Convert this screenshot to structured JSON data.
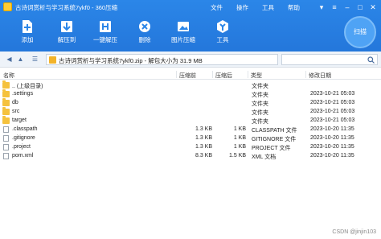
{
  "window": {
    "title": "古诗词赏析与学习系统7ykf0 - 360压缩",
    "menu": [
      "文件",
      "操作",
      "工具",
      "帮助"
    ]
  },
  "toolbar": {
    "items": [
      {
        "label": "添加",
        "icon": "add-file-icon"
      },
      {
        "label": "解压到",
        "icon": "extract-to-icon"
      },
      {
        "label": "一键解压",
        "icon": "one-click-extract-icon"
      },
      {
        "label": "删除",
        "icon": "delete-icon"
      },
      {
        "label": "图片压缩",
        "icon": "image-compress-icon"
      },
      {
        "label": "工具",
        "icon": "tools-icon"
      }
    ],
    "scan_label": "扫描"
  },
  "address": {
    "path": "古诗词赏析与学习系统7ykf0.zip - 解包大小为 31.9 MB",
    "v_badge": "V"
  },
  "table": {
    "headers": [
      "名称",
      "压缩前",
      "压缩后",
      "类型",
      "修改日期"
    ],
    "rows": [
      {
        "name": ".. (上级目录)",
        "before": "",
        "after": "",
        "type": "文件夹",
        "date": "",
        "kind": "folder"
      },
      {
        "name": ".settings",
        "before": "",
        "after": "",
        "type": "文件夹",
        "date": "2023-10-21 05:03",
        "kind": "folder"
      },
      {
        "name": "db",
        "before": "",
        "after": "",
        "type": "文件夹",
        "date": "2023-10-21 05:03",
        "kind": "folder"
      },
      {
        "name": "src",
        "before": "",
        "after": "",
        "type": "文件夹",
        "date": "2023-10-21 05:03",
        "kind": "folder"
      },
      {
        "name": "target",
        "before": "",
        "after": "",
        "type": "文件夹",
        "date": "2023-10-21 05:03",
        "kind": "folder"
      },
      {
        "name": ".classpath",
        "before": "1.3 KB",
        "after": "1 KB",
        "type": "CLASSPATH 文件",
        "date": "2023-10-20 11:35",
        "kind": "file"
      },
      {
        "name": ".gitignore",
        "before": "1.3 KB",
        "after": "1 KB",
        "type": "GITIGNORE 文件",
        "date": "2023-10-20 11:35",
        "kind": "file"
      },
      {
        "name": ".project",
        "before": "1.3 KB",
        "after": "1 KB",
        "type": "PROJECT 文件",
        "date": "2023-10-20 11:35",
        "kind": "file"
      },
      {
        "name": "pom.xml",
        "before": "8.3 KB",
        "after": "1.5 KB",
        "type": "XML 文档",
        "date": "2023-10-20 11:35",
        "kind": "file"
      }
    ]
  },
  "watermark": "CSDN @jinjin103"
}
